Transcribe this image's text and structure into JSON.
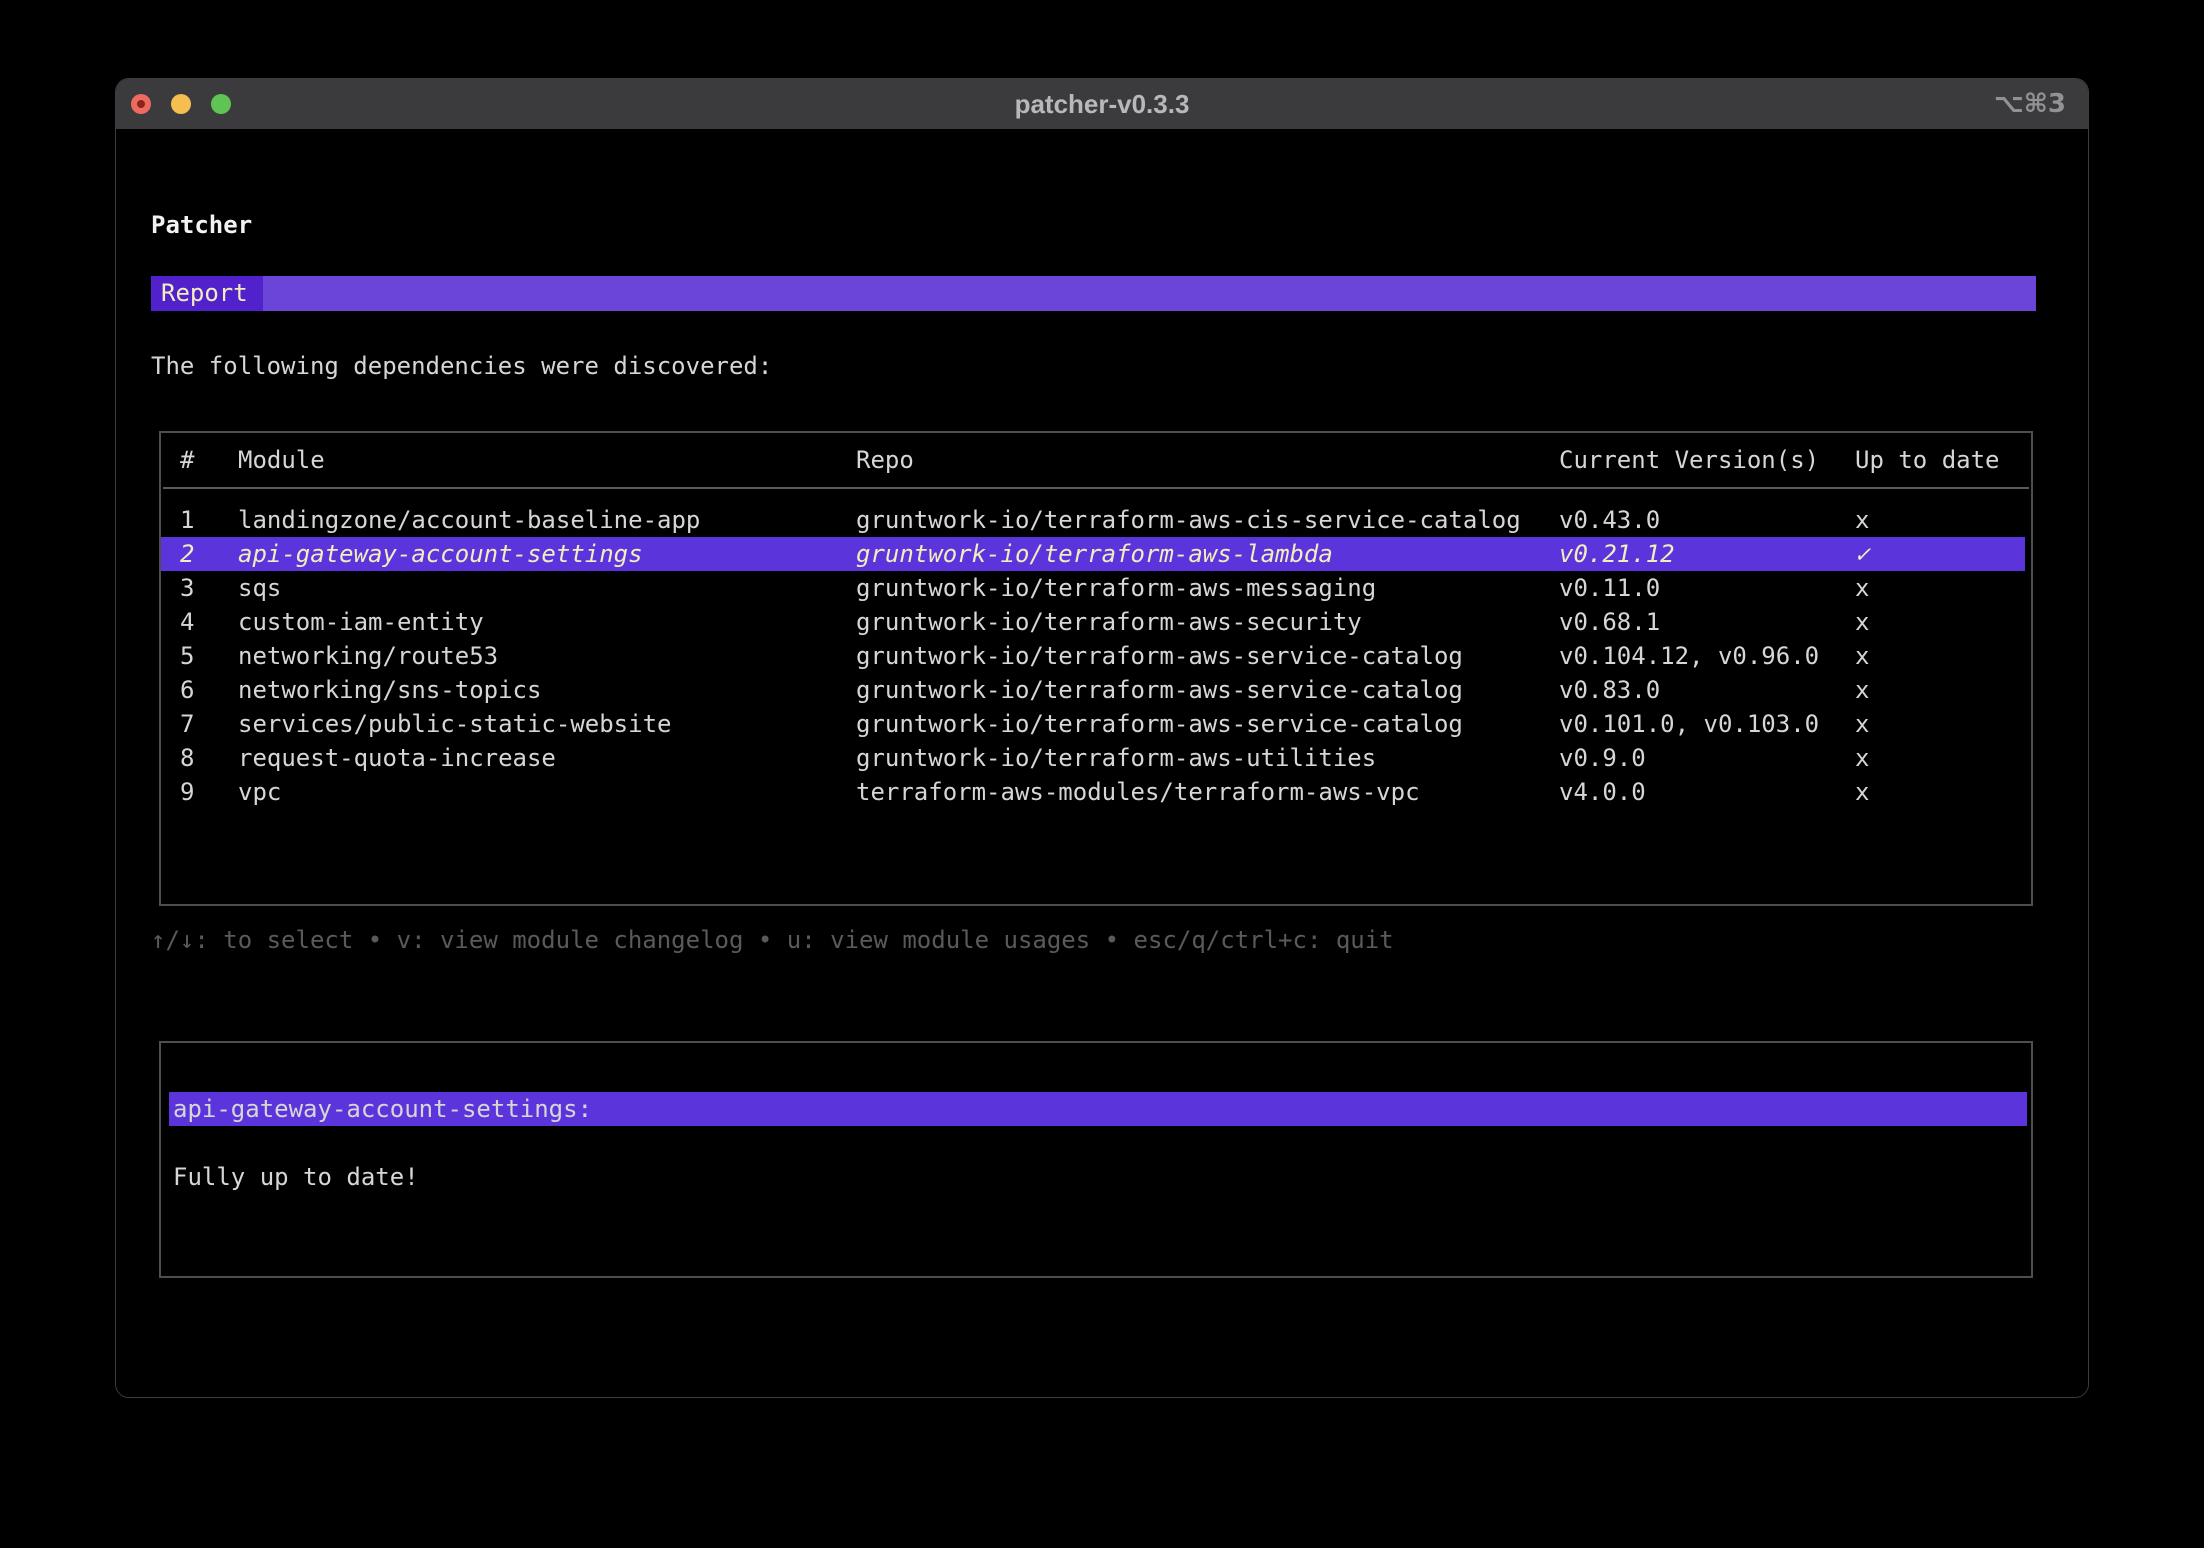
{
  "window": {
    "title": "patcher-v0.3.3",
    "shortcut": "⌥⌘3",
    "traffic_lights": [
      "close-button",
      "minimize-button",
      "zoom-button"
    ]
  },
  "app": {
    "title": "Patcher",
    "tab_label": "Report",
    "intro": "The following dependencies were discovered:",
    "help": "↑/↓: to select • v: view module changelog • u: view module usages • esc/q/ctrl+c: quit"
  },
  "table": {
    "headers": {
      "num": "#",
      "module": "Module",
      "repo": "Repo",
      "version": "Current Version(s)",
      "uptodate": "Up to date"
    },
    "rows": [
      {
        "num": "1",
        "module": "landingzone/account-baseline-app",
        "repo": "gruntwork-io/terraform-aws-cis-service-catalog",
        "version": "v0.43.0",
        "uptodate": "x",
        "selected": false
      },
      {
        "num": "2",
        "module": "api-gateway-account-settings",
        "repo": "gruntwork-io/terraform-aws-lambda",
        "version": "v0.21.12",
        "uptodate": "✓",
        "selected": true
      },
      {
        "num": "3",
        "module": "sqs",
        "repo": "gruntwork-io/terraform-aws-messaging",
        "version": "v0.11.0",
        "uptodate": "x",
        "selected": false
      },
      {
        "num": "4",
        "module": "custom-iam-entity",
        "repo": "gruntwork-io/terraform-aws-security",
        "version": "v0.68.1",
        "uptodate": "x",
        "selected": false
      },
      {
        "num": "5",
        "module": "networking/route53",
        "repo": "gruntwork-io/terraform-aws-service-catalog",
        "version": "v0.104.12, v0.96.0",
        "uptodate": "x",
        "selected": false
      },
      {
        "num": "6",
        "module": "networking/sns-topics",
        "repo": "gruntwork-io/terraform-aws-service-catalog",
        "version": "v0.83.0",
        "uptodate": "x",
        "selected": false
      },
      {
        "num": "7",
        "module": "services/public-static-website",
        "repo": "gruntwork-io/terraform-aws-service-catalog",
        "version": "v0.101.0, v0.103.0",
        "uptodate": "x",
        "selected": false
      },
      {
        "num": "8",
        "module": "request-quota-increase",
        "repo": "gruntwork-io/terraform-aws-utilities",
        "version": "v0.9.0",
        "uptodate": "x",
        "selected": false
      },
      {
        "num": "9",
        "module": "vpc",
        "repo": "terraform-aws-modules/terraform-aws-vpc",
        "version": "v4.0.0",
        "uptodate": "x",
        "selected": false
      }
    ]
  },
  "detail": {
    "heading": "api-gateway-account-settings:",
    "body": "Fully up to date!"
  },
  "colors": {
    "accent": "#5b35db",
    "tab_active": "#5122cc",
    "tab_bar": "#6b44d8",
    "cream": "#f2ecbe",
    "fg": "#d6d6d6",
    "dim": "#5a5a5c",
    "titlebar_bg": "#3b3b3d",
    "border_gray": "#4e4e4e",
    "traffic_red": "#ee6a5f",
    "traffic_yellow": "#f4bf50",
    "traffic_green": "#5fc454"
  }
}
